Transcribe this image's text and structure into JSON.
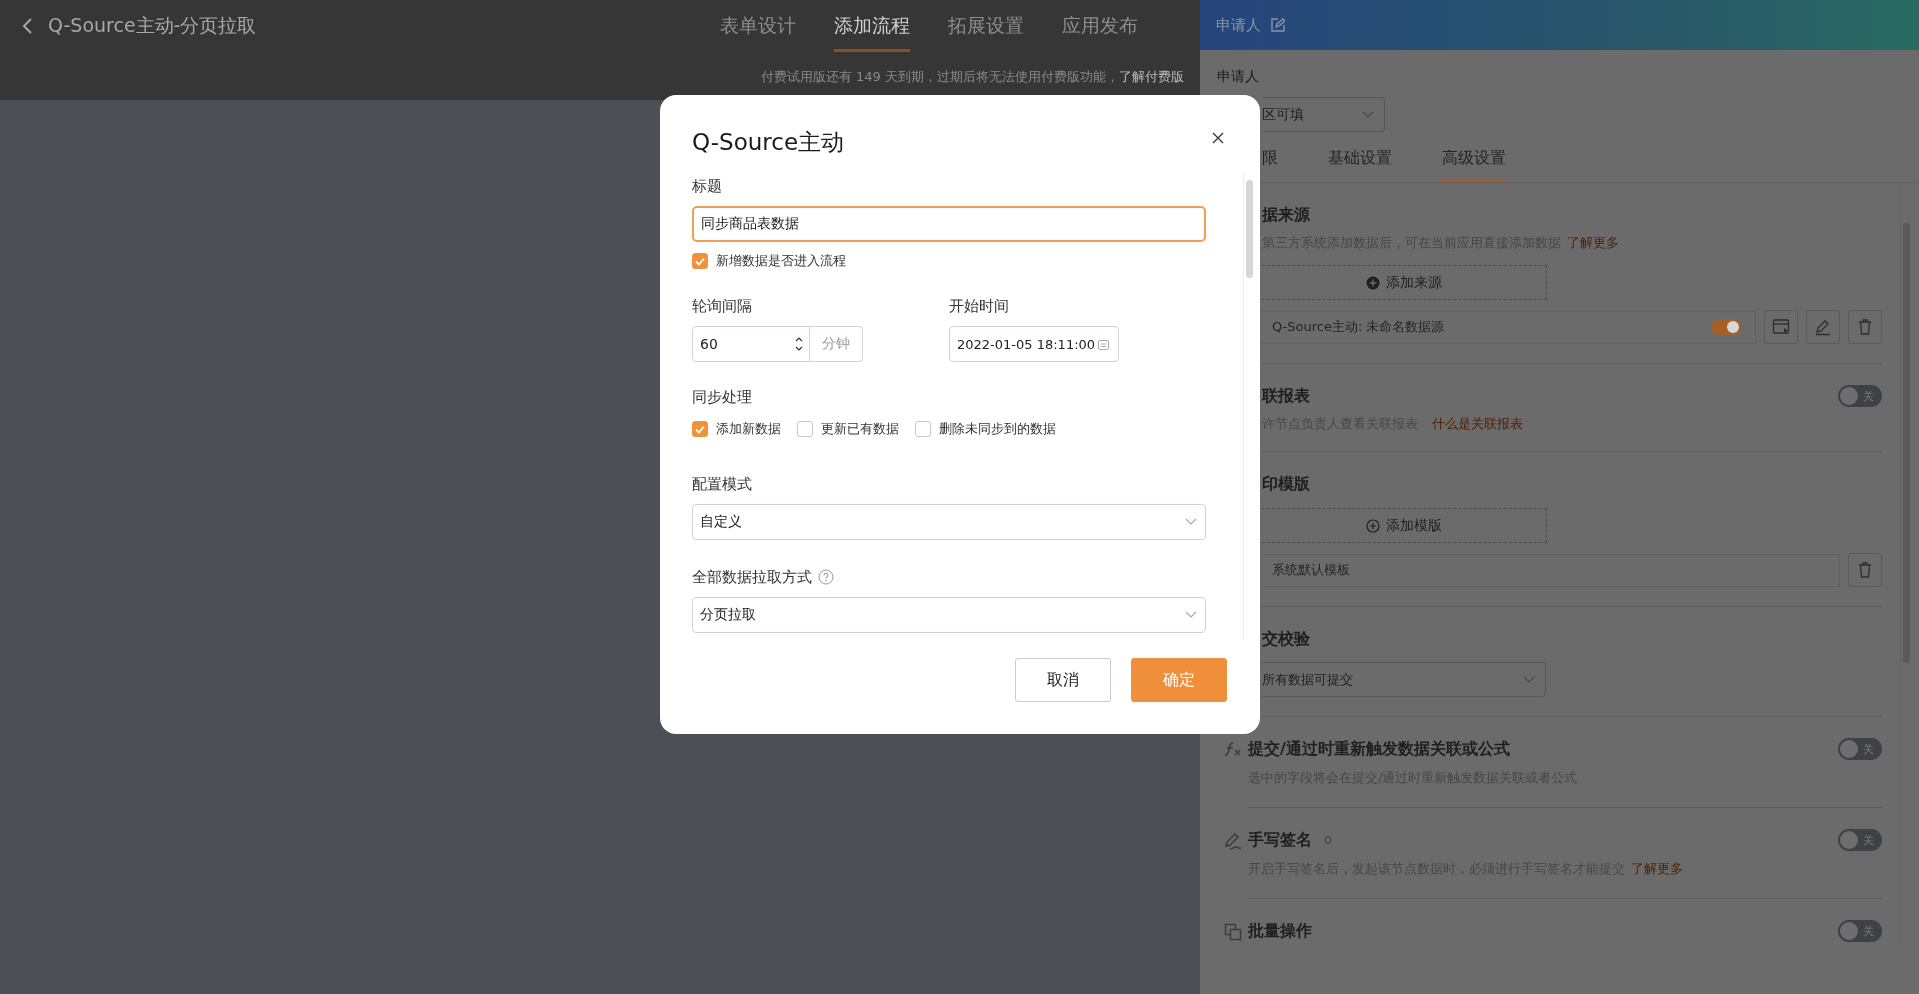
{
  "page_header": {
    "title": "Q-Source主动-分页拉取",
    "tabs": [
      {
        "label": "表单设计",
        "selected": false
      },
      {
        "label": "添加流程",
        "selected": true
      },
      {
        "label": "拓展设置",
        "selected": false
      },
      {
        "label": "应用发布",
        "selected": false
      }
    ],
    "notice": {
      "text": "付费试用版还有 149 天到期，过期后将无法使用付费版功能，",
      "link": "了解付费版"
    }
  },
  "side_panel": {
    "title": "申请人",
    "field_label": "申请人",
    "field_value": "区可填",
    "tabs": [
      {
        "label": "限",
        "selected": false
      },
      {
        "label": "基础设置",
        "selected": false
      },
      {
        "label": "高级设置",
        "selected": true
      }
    ],
    "sections": [
      {
        "kind": "source",
        "title": "据来源",
        "description": "第三方系统添加数据后，可在当前应用直接添加数据",
        "link": "了解更多",
        "add_button": "添加来源",
        "items": [
          {
            "label": "Q-Source主动: 未命名数据源",
            "on": true
          }
        ]
      },
      {
        "kind": "toggle",
        "title": "联报表",
        "description": "许节点负责人查看关联报表",
        "link": "什么是关联报表",
        "on": false,
        "toggle_label": "关"
      },
      {
        "kind": "template",
        "title": "印模版",
        "add_button": "添加模版",
        "items": [
          {
            "label": "系统默认模板"
          }
        ]
      },
      {
        "kind": "select",
        "title": "交校验",
        "value": "所有数据可提交"
      },
      {
        "kind": "toggle",
        "icon": true,
        "title": "提交/通过时重新触发数据关联或公式",
        "description": "选中的字段将会在提交/通过时重新触发数据关联或者公式",
        "on": false,
        "toggle_label": "关"
      },
      {
        "kind": "toggle",
        "icon": true,
        "info_icon": true,
        "title": "手写签名",
        "description": "开启手写签名后，发起该节点数据时，必须进行手写签名才能提交",
        "link": "了解更多",
        "on": false,
        "toggle_label": "关"
      },
      {
        "kind": "toggle",
        "icon": true,
        "title": "批量操作",
        "on": false,
        "toggle_label": "关"
      }
    ]
  },
  "dialog": {
    "title": "Q-Source主动",
    "title_label": "标题",
    "title_value": "同步商品表数据",
    "enter_flow": {
      "label": "新增数据是否进入流程",
      "checked": true
    },
    "interval": {
      "label": "轮询间隔",
      "value": "60",
      "unit": "分钟"
    },
    "start_time": {
      "label": "开始时间",
      "value": "2022-01-05 18:11:00"
    },
    "sync": {
      "label": "同步处理",
      "options": [
        {
          "label": "添加新数据",
          "checked": true
        },
        {
          "label": "更新已有数据",
          "checked": false
        },
        {
          "label": "删除未同步到的数据",
          "checked": false
        }
      ]
    },
    "mode": {
      "label": "配置模式",
      "value": "自定义"
    },
    "fetch": {
      "label": "全部数据拉取方式",
      "value": "分页拉取"
    },
    "buttons": [
      {
        "label": "取消",
        "kind": "secondary"
      },
      {
        "label": "确定",
        "kind": "primary"
      }
    ]
  }
}
